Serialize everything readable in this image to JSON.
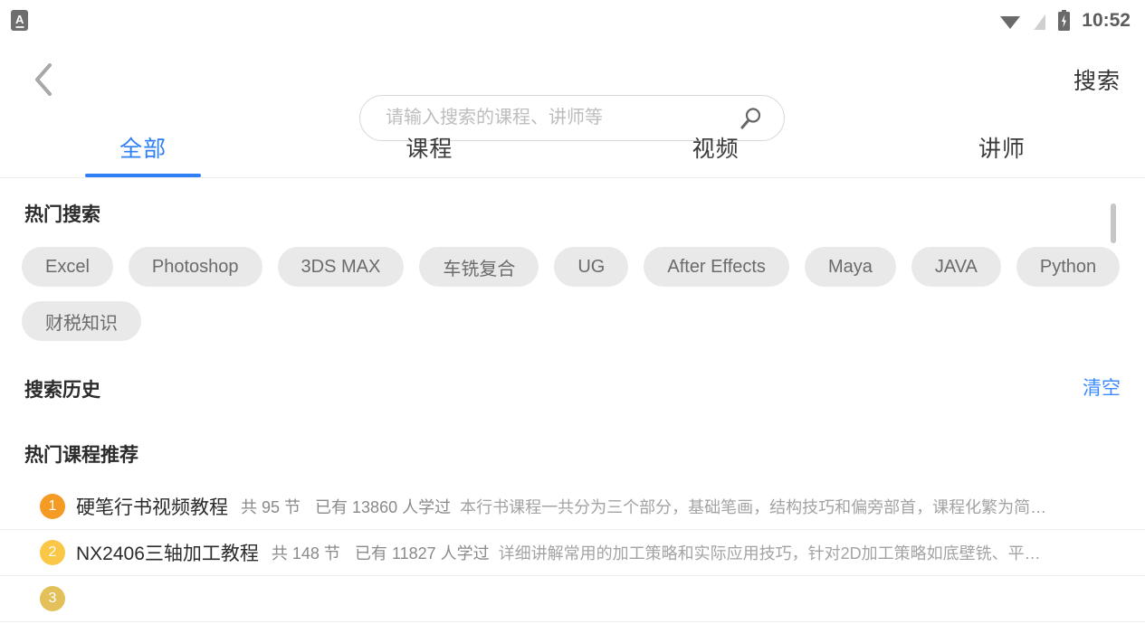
{
  "status_bar": {
    "app_icon": "app-notification-icon",
    "app_icon_letter": "A",
    "wifi_icon": "wifi-icon",
    "signal_icon": "signal-off-icon",
    "battery_icon": "battery-charging-icon",
    "time": "10:52"
  },
  "header": {
    "back_icon": "back-chevron-icon",
    "search_placeholder": "请输入搜索的课程、讲师等",
    "search_value": "",
    "magnifier_icon": "search-icon",
    "search_button": "搜索"
  },
  "tabs": [
    {
      "label": "全部",
      "active": true
    },
    {
      "label": "课程",
      "active": false
    },
    {
      "label": "视频",
      "active": false
    },
    {
      "label": "讲师",
      "active": false
    }
  ],
  "hot_search": {
    "title": "热门搜索",
    "chips": [
      "Excel",
      "Photoshop",
      "3DS MAX",
      "车铣复合",
      "UG",
      "After Effects",
      "Maya",
      "JAVA",
      "Python",
      "财税知识"
    ]
  },
  "search_history": {
    "title": "搜索历史",
    "clear_label": "清空",
    "items": []
  },
  "recommend": {
    "title": "热门课程推荐",
    "courses": [
      {
        "rank": "1",
        "rank_color": "#f59a23",
        "title": "硬笔行书视频教程",
        "lessons": "共 95 节",
        "learners": "已有 13860 人学过",
        "desc": "本行书课程一共分为三个部分，基础笔画，结构技巧和偏旁部首，课程化繁为简…"
      },
      {
        "rank": "2",
        "rank_color": "#fac846",
        "title": "NX2406三轴加工教程",
        "lessons": "共 148 节",
        "learners": "已有 11827 人学过",
        "desc": "详细讲解常用的加工策略和实际应用技巧，针对2D加工策略如底壁铣、平…"
      },
      {
        "rank": "3",
        "rank_color": "#e3c05a",
        "title": "",
        "lessons": "",
        "learners": "",
        "desc": ""
      }
    ]
  },
  "colors": {
    "accent_blue": "#2f7ff5",
    "link_blue": "#3d8bff",
    "chip_bg": "#e9e9e9",
    "text_primary": "#2b2b2b",
    "text_muted": "#8a8a8a"
  }
}
